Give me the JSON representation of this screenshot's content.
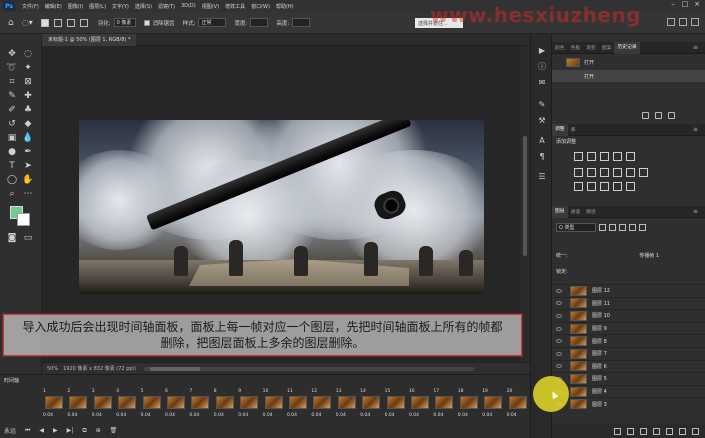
{
  "menubar": {
    "items": [
      "文件(F)",
      "编辑(E)",
      "图像(I)",
      "图层(L)",
      "文字(Y)",
      "选择(S)",
      "滤镜(T)",
      "3D(D)",
      "视图(V)",
      "增效工具",
      "窗口(W)",
      "帮助(H)"
    ],
    "ps_logo": "Ps"
  },
  "watermark": "www.hesxiuzheng",
  "options": {
    "feather_label": "羽化:",
    "feather_value": "0 像素",
    "antialias_label": "消除锯齿",
    "style_label": "样式:",
    "style_value": "正常",
    "width_label": "宽度:",
    "height_label": "高度:",
    "select_mask_btn": "选择并遮住..."
  },
  "document": {
    "tab_title": "未标题-1 @ 50% (图层 1, RGB/8) *",
    "zoom": "50%",
    "doc_info": "1920 像素 x 832 像素 (72 ppi)"
  },
  "subtitle": {
    "line1": "导入成功后会出现时间轴面板，面板上每一帧对应一个图层，先把时间轴面板上所有的帧都",
    "line2": "删除，把图层面板上多余的图层删除。"
  },
  "timeline": {
    "title": "时间轴",
    "frames": [
      {
        "num": "1",
        "dur": "0.04"
      },
      {
        "num": "2",
        "dur": "0.04"
      },
      {
        "num": "3",
        "dur": "0.04"
      },
      {
        "num": "4",
        "dur": "0.04"
      },
      {
        "num": "5",
        "dur": "0.04"
      },
      {
        "num": "6",
        "dur": "0.04"
      },
      {
        "num": "7",
        "dur": "0.04"
      },
      {
        "num": "8",
        "dur": "0.04"
      },
      {
        "num": "9",
        "dur": "0.04"
      },
      {
        "num": "10",
        "dur": "0.04"
      },
      {
        "num": "11",
        "dur": "0.04"
      },
      {
        "num": "12",
        "dur": "0.04"
      },
      {
        "num": "13",
        "dur": "0.04"
      },
      {
        "num": "14",
        "dur": "0.04"
      },
      {
        "num": "15",
        "dur": "0.04"
      },
      {
        "num": "16",
        "dur": "0.04"
      },
      {
        "num": "17",
        "dur": "0.04"
      },
      {
        "num": "18",
        "dur": "0.04"
      },
      {
        "num": "19",
        "dur": "0.04"
      },
      {
        "num": "20",
        "dur": "0.04"
      }
    ],
    "loop": "永远"
  },
  "panels": {
    "history_tabs": [
      "颜色",
      "色板",
      "渐变",
      "图案",
      "历史记录"
    ],
    "history_items": [
      "打开",
      "打开"
    ],
    "adjust_tabs": [
      "调整",
      "库"
    ],
    "adjust_title": "添加调整",
    "layers_tabs": [
      "图层",
      "通道",
      "路径"
    ],
    "layer_filter": "Q 类型",
    "layer_opts": "锁定:",
    "propagate": "传播帧 1",
    "unify": "统一:",
    "layers": [
      "图层 12",
      "图层 11",
      "图层 10",
      "图层 9",
      "图层 8",
      "图层 7",
      "图层 6",
      "图层 5",
      "图层 4",
      "图层 3"
    ]
  }
}
